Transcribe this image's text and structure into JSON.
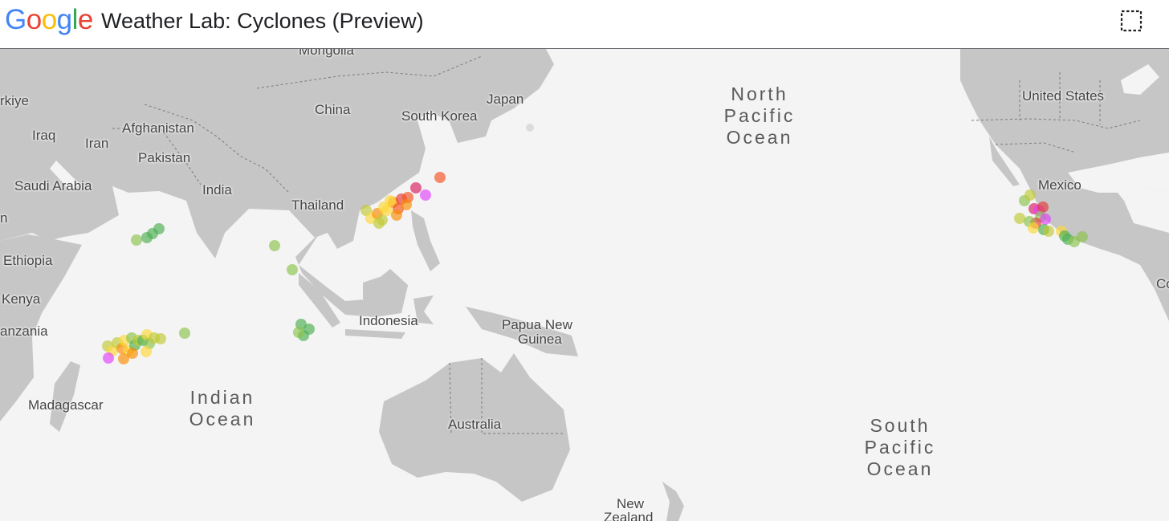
{
  "header": {
    "logo": [
      "G",
      "o",
      "o",
      "g",
      "l",
      "e"
    ],
    "logo_colors": [
      "#4285F4",
      "#EA4335",
      "#FBBC05",
      "#4285F4",
      "#34A853",
      "#EA4335"
    ],
    "title": "Weather Lab: Cyclones (Preview)",
    "select_icon": "dashed-square-icon"
  },
  "map": {
    "land_color": "#c6c6c6",
    "water_color": "#f4f4f4",
    "countries": {
      "mongolia": "Mongolia",
      "turkiye": "rkiye",
      "iraq": "Iraq",
      "iran": "Iran",
      "afghanistan": "Afghanistan",
      "pakistan": "Pakistan",
      "china": "China",
      "south_korea": "South Korea",
      "japan": "Japan",
      "saudi_arabia": "Saudi Arabia",
      "india": "India",
      "thailand": "Thailand",
      "ethiopia": "Ethiopia",
      "kenya": "Kenya",
      "tanzania": "anzania",
      "madagascar": "Madagascar",
      "indonesia": "Indonesia",
      "papua_new_guinea_1": "Papua New",
      "papua_new_guinea_2": "Guinea",
      "australia": "Australia",
      "new_zealand_1": "New",
      "new_zealand_2": "Zealand",
      "united_states": "United States",
      "mexico": "Mexico",
      "co": "Co",
      "n": "n"
    },
    "oceans": {
      "north_pacific": [
        "North",
        "Pacific",
        "Ocean"
      ],
      "indian": [
        "Indian",
        "Ocean"
      ],
      "south_pacific": [
        "South",
        "Pacific",
        "Ocean"
      ]
    },
    "cyclone_colors": {
      "green": "#4caf50",
      "light_green": "#8bc34a",
      "yellow_green": "#c0ca33",
      "yellow": "#fdd835",
      "orange": "#fb8c00",
      "red_orange": "#f4511e",
      "red": "#e53935",
      "magenta": "#d81b60",
      "pink": "#e040fb"
    }
  }
}
